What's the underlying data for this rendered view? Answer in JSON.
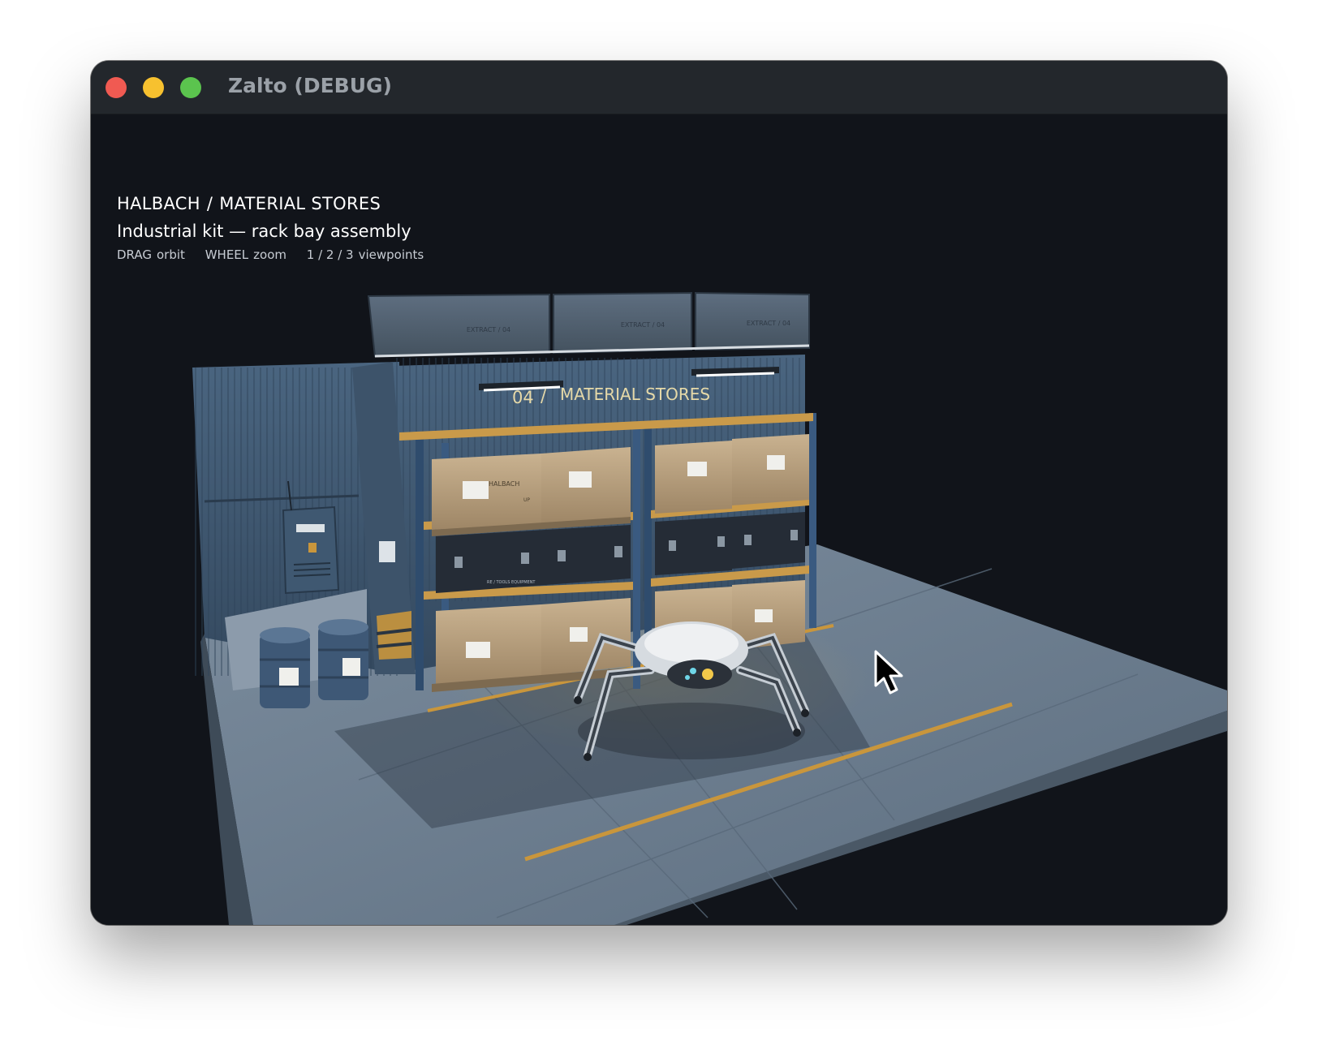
{
  "window": {
    "title": "Zalto (DEBUG)"
  },
  "hud": {
    "breadcrumb": [
      "HALBACH",
      "MATERIAL STORES"
    ],
    "breadcrumb_separator": "/",
    "subtitle": "Industrial kit — rack bay assembly",
    "controls": [
      {
        "key": "DRAG",
        "action": "orbit"
      },
      {
        "key": "WHEEL",
        "action": "zoom"
      },
      {
        "key": "1 / 2 / 3",
        "action": "viewpoints"
      }
    ]
  },
  "scene": {
    "sign_number": "04",
    "sign_separator": "/",
    "sign_text": "MATERIAL STORES",
    "duct_labels": [
      "EXTRACT / 04",
      "EXTRACT / 04",
      "EXTRACT / 04"
    ],
    "crate_brand": "HALBACH",
    "crate_mark": "UP",
    "case_label": "RE / TOOLS EQUIPMENT",
    "colors": {
      "background": "#11141a",
      "wall": "#3e5670",
      "floor": "#6e8092",
      "crate": "#b59d7c",
      "case": "#252c36",
      "rack_beam": "#c99a4a",
      "floor_stripe": "#c9963c",
      "sign_text": "#e6d9a8"
    }
  }
}
